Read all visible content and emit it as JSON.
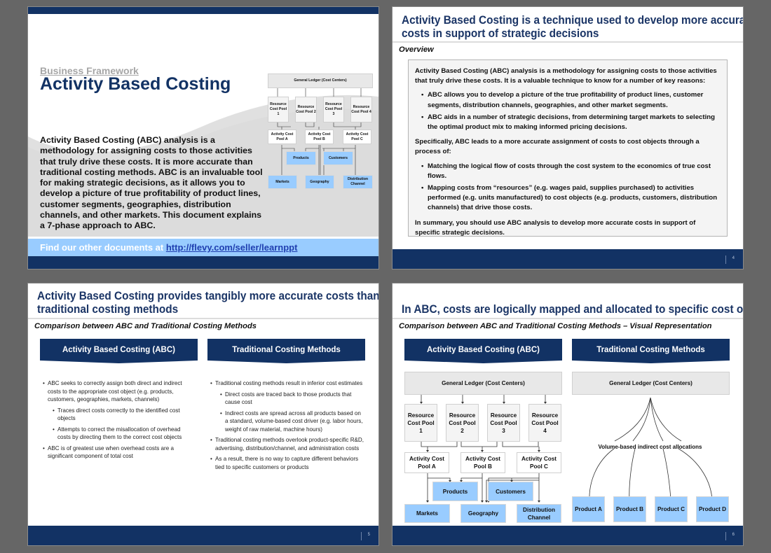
{
  "slides": [
    {
      "kicker": "Business Framework",
      "title": "Activity Based Costing",
      "body": "Activity Based Costing (ABC) analysis is a methodology for assigning costs to those activities that truly drive these costs.  It is more accurate than traditional costing methods. ABC is an invaluable tool for making strategic decisions, as it allows you to develop a picture of true profitability of product lines, customer segments, geographies, distribution channels, and other markets. This document explains a 7-phase approach to ABC.",
      "promo_text": "Find our other documents at ",
      "promo_link": "http://flevy.com/seller/learnppt",
      "diagram": {
        "ledger": "General Ledger (Cost Centers)",
        "resource_pools": [
          "Resource Cost Pool 1",
          "Resource Cost Pool 2",
          "Resource Cost Pool 3",
          "Resource Cost Pool 4"
        ],
        "activity_pools": [
          "Activity Cost Pool A",
          "Activity Cost Pool B",
          "Activity Cost Pool C"
        ],
        "mid_objects": [
          "Products",
          "Customers"
        ],
        "bottom_objects": [
          "Markets",
          "Geography",
          "Distribution Channel"
        ]
      }
    },
    {
      "title_line1": "Activity Based Costing is a technique used to develop more accurate",
      "title_line2": "costs in support of strategic decisions",
      "subtitle": "Overview",
      "intro": "Activity Based Costing (ABC) analysis is a methodology for assigning costs to those activities that truly drive these costs.  It is a valuable technique to know for a number of key reasons:",
      "reasons": [
        "ABC allows you to develop a picture of the true profitability of product lines, customer segments, distribution channels, geographies, and other market segments.",
        "ABC aids in a number of strategic decisions, from determining target markets to selecting the optimal product mix to making informed pricing decisions."
      ],
      "specifically": "Specifically, ABC leads to a more accurate assignment of costs to cost objects through a process of:",
      "process": [
        "Matching the logical flow of costs through the cost system to the economics of true cost flows.",
        "Mapping costs from “resources” (e.g. wages paid, supplies purchased) to activities performed (e.g. units manufactured) to cost objects (e.g. products, customers, distribution channels) that drive those costs."
      ],
      "summary": "In summary, you should use ABC analysis to develop more accurate costs in support of specific strategic decisions.",
      "page": "4"
    },
    {
      "title_line1": "Activity Based Costing provides tangibly more accurate costs than",
      "title_line2": "traditional costing methods",
      "subtitle": "Comparison between ABC and Traditional Costing Methods",
      "left_header": "Activity Based Costing (ABC)",
      "right_header": "Traditional Costing Methods",
      "left_items": [
        {
          "level": 1,
          "text": "ABC seeks to correctly assign both direct and indirect costs to the appropriate cost object (e.g. products, customers, geographies, markets, channels)"
        },
        {
          "level": 2,
          "text": "Traces direct costs correctly to the identified cost objects"
        },
        {
          "level": 2,
          "text": "Attempts to correct the misallocation of overhead costs by directing them to the correct cost objects"
        },
        {
          "level": 1,
          "text": "ABC is of greatest use when overhead costs are a significant component of total cost"
        }
      ],
      "right_items": [
        {
          "level": 1,
          "text": "Traditional costing methods result in inferior cost estimates"
        },
        {
          "level": 2,
          "text": "Direct costs are traced back to those products that cause cost"
        },
        {
          "level": 2,
          "text": "Indirect costs are spread across all products based on a standard, volume-based cost driver (e.g. labor hours, weight of raw material, machine hours)"
        },
        {
          "level": 1,
          "text": "Traditional costing methods overlook product-specific R&D, advertising, distribution/channel, and administration costs"
        },
        {
          "level": 1,
          "text": "As a result, there is no way to capture different behaviors tied to specific customers or products"
        }
      ],
      "page": "5"
    },
    {
      "title_line1": "In ABC, costs are logically mapped and allocated to specific cost objects",
      "subtitle": "Comparison between ABC and Traditional Costing Methods – Visual Representation",
      "left_header": "Activity Based Costing (ABC)",
      "right_header": "Traditional Costing Methods",
      "abc": {
        "ledger": "General Ledger (Cost Centers)",
        "resource_pools": [
          "Resource Cost Pool 1",
          "Resource Cost Pool 2",
          "Resource Cost Pool 3",
          "Resource Cost Pool 4"
        ],
        "activity_pools": [
          "Activity Cost Pool A",
          "Activity Cost Pool B",
          "Activity Cost Pool C"
        ],
        "mid_objects": [
          "Products",
          "Customers"
        ],
        "bottom_objects": [
          "Markets",
          "Geography",
          "Distribution Channel"
        ]
      },
      "traditional": {
        "ledger": "General Ledger (Cost Centers)",
        "allocation_label": "Volume-based indirect cost allocations",
        "products": [
          "Product A",
          "Product B",
          "Product C",
          "Product D"
        ]
      },
      "page": "6"
    }
  ],
  "colors": {
    "navy": "#123264",
    "title_blue": "#1b3566",
    "light_blue": "#99ccff",
    "gray_box": "#e8e8e8",
    "background": "#666666"
  }
}
